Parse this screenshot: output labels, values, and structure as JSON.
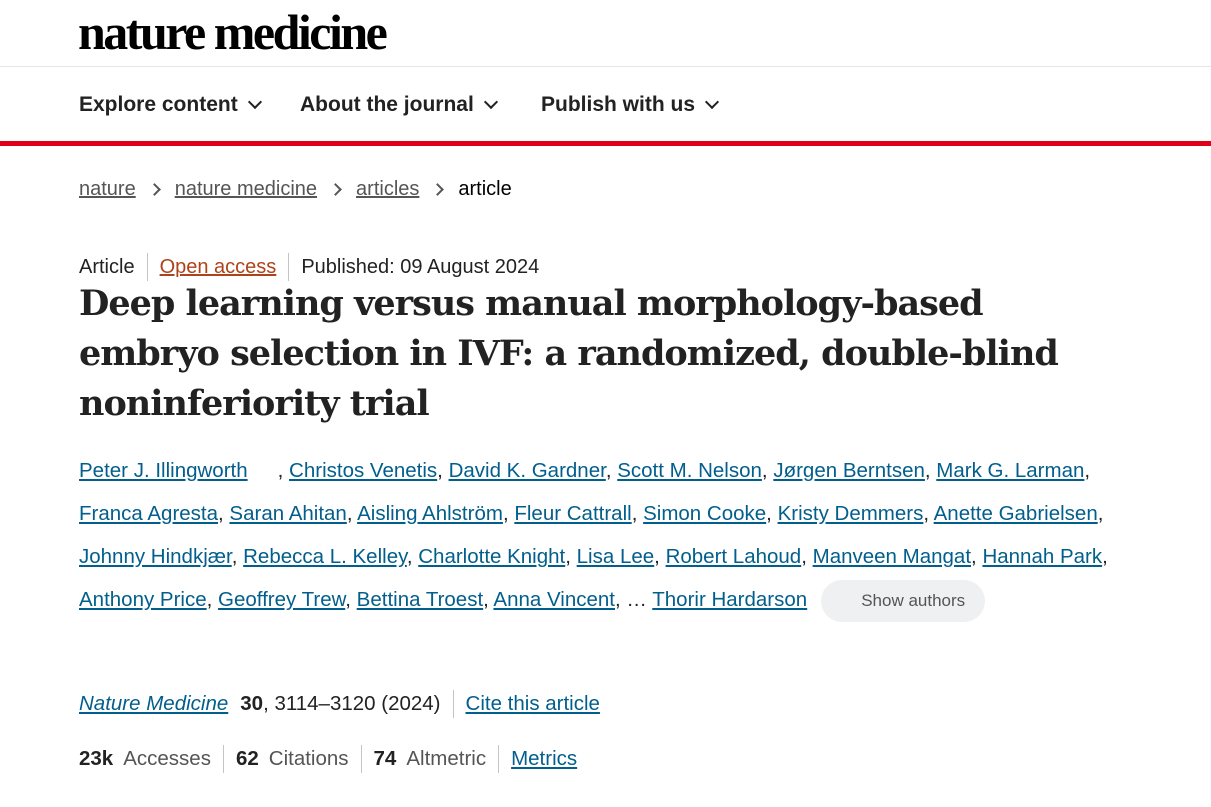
{
  "header": {
    "logo": "nature medicine"
  },
  "nav": {
    "items": [
      "Explore content",
      "About the journal",
      "Publish with us"
    ]
  },
  "breadcrumb": {
    "items": [
      "nature",
      "nature medicine",
      "articles"
    ],
    "current": "article"
  },
  "article": {
    "type": "Article",
    "access": "Open access",
    "published": "Published: 09 August 2024",
    "title": "Deep learning versus manual morphology-based embryo selection in IVF: a randomized, double-blind noninferiority trial",
    "authors": [
      "Peter J. Illingworth",
      "Christos Venetis",
      "David K. Gardner",
      "Scott M. Nelson",
      "Jørgen Berntsen",
      "Mark G. Larman",
      "Franca Agresta",
      "Saran Ahitan",
      "Aisling Ahlström",
      "Fleur Cattrall",
      "Simon Cooke",
      "Kristy Demmers",
      "Anette Gabrielsen",
      "Johnny Hindkjær",
      "Rebecca L. Kelley",
      "Charlotte Knight",
      "Lisa Lee",
      "Robert Lahoud",
      "Manveen Mangat",
      "Hannah Park",
      "Anthony Price",
      "Geoffrey Trew",
      "Bettina Troest",
      "Anna Vincent",
      "Thorir Hardarson"
    ],
    "ellipsis": "…",
    "show_authors": "Show authors",
    "journal": "Nature Medicine",
    "volume": "30",
    "pages": ", 3114–3120 (2024)",
    "cite": "Cite this article"
  },
  "metrics": {
    "accesses_value": "23k",
    "accesses_label": "Accesses",
    "citations_value": "62",
    "citations_label": "Citations",
    "altmetric_value": "74",
    "altmetric_label": "Altmetric",
    "metrics_link": "Metrics"
  }
}
